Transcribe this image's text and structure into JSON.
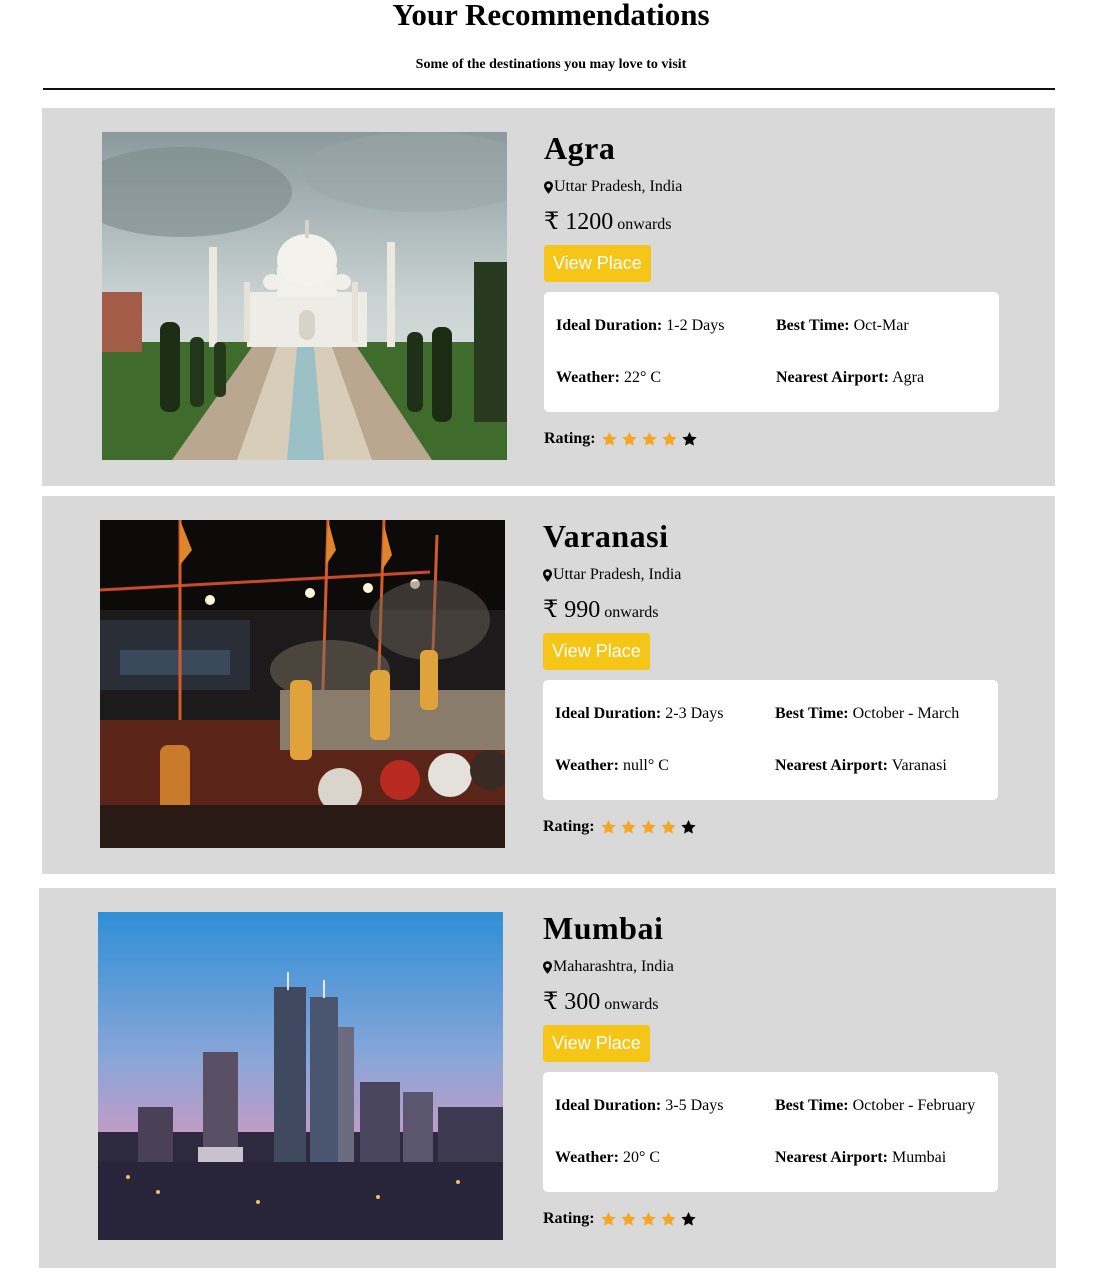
{
  "header": {
    "title": "Your Recommendations",
    "subtitle": "Some of the destinations you may love to visit"
  },
  "labels": {
    "ideal_duration": "Ideal Duration:",
    "best_time": "Best Time:",
    "weather": "Weather:",
    "nearest_airport": "Nearest Airport:",
    "rating": "Rating:",
    "view_place": "View Place",
    "onwards": "onwards"
  },
  "colors": {
    "card_bg": "#d9d9d9",
    "button_bg": "#f5c518",
    "star_filled": "#f5a623",
    "star_empty": "#000000"
  },
  "places": [
    {
      "name": "Agra",
      "location": "Uttar Pradesh, India",
      "price": "₹ 1200",
      "ideal_duration": "1-2 Days",
      "best_time": "Oct-Mar",
      "weather": "22° C",
      "nearest_airport": "Agra",
      "rating": 4,
      "rating_max": 5,
      "image": "taj-mahal-photo"
    },
    {
      "name": "Varanasi",
      "location": "Uttar Pradesh, India",
      "price": "₹ 990",
      "ideal_duration": "2-3 Days",
      "best_time": "October - March",
      "weather": "null° C",
      "nearest_airport": "Varanasi",
      "rating": 4,
      "rating_max": 5,
      "image": "ganga-aarti-photo"
    },
    {
      "name": "Mumbai",
      "location": "Maharashtra, India",
      "price": "₹ 300",
      "ideal_duration": "3-5 Days",
      "best_time": "October - February",
      "weather": "20° C",
      "nearest_airport": "Mumbai",
      "rating": 4,
      "rating_max": 5,
      "image": "mumbai-skyline-photo"
    }
  ]
}
